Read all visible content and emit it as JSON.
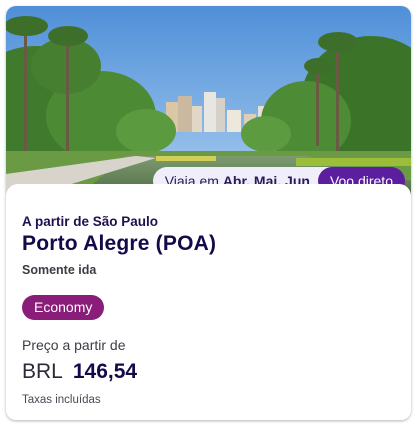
{
  "card": {
    "image_alt": "Park with trees and city skyline",
    "travel_months_prefix": "Viaja em",
    "travel_months": "Abr, Mai, Jun",
    "direct_badge": "Voo direto",
    "origin": "A partir de São Paulo",
    "destination": "Porto Alegre (POA)",
    "trip_type": "Somente ida",
    "cabin_class": "Economy",
    "price_label": "Preço a partir de",
    "currency": "BRL",
    "amount": "146,54",
    "tax_note": "Taxas incluídas"
  },
  "colors": {
    "brand_purple": "#5b1e9e",
    "cabin_magenta": "#8a1c7a",
    "title_navy": "#130a4a"
  }
}
